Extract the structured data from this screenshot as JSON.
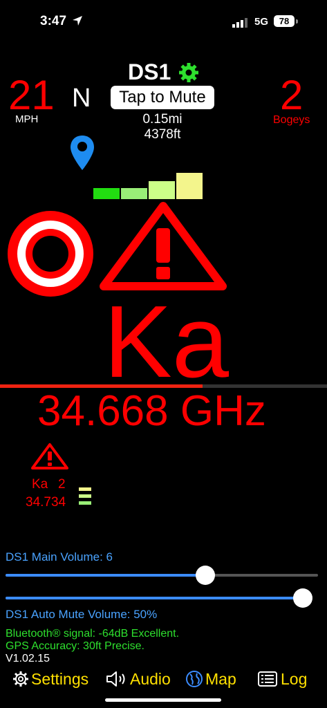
{
  "status_bar": {
    "time": "3:47",
    "network": "5G",
    "battery": "78"
  },
  "speed": {
    "value": "21",
    "unit": "MPH"
  },
  "heading": "N",
  "device": {
    "name": "DS1",
    "mute_label": "Tap to Mute",
    "distance_mi": "0.15mi",
    "distance_ft": "4378ft"
  },
  "bogeys": {
    "count": "2",
    "label": "Bogeys"
  },
  "signal_strength_level": 4,
  "alert": {
    "band": "Ka",
    "frequency": "34.668 GHz",
    "progress_fraction": 0.62
  },
  "secondary_alert": {
    "band": "Ka",
    "count": "2",
    "frequency": "34.734",
    "level": 3
  },
  "volume": {
    "main_label": "DS1 Main Volume: 6",
    "main_level": 0.64,
    "auto_mute_label": "DS1 Auto Mute Volume: 50%",
    "auto_mute_level": 1.0
  },
  "info": {
    "bluetooth": "Bluetooth® signal: -64dB Excellent.",
    "gps": "GPS Accuracy: 30ft Precise.",
    "version": "V1.02.15"
  },
  "nav": {
    "settings": "Settings",
    "audio": "Audio",
    "map": "Map",
    "log": "Log"
  },
  "colors": {
    "alert": "#ff0000",
    "accent": "#ffe000",
    "blue": "#3b8cff",
    "green": "#2ee02e"
  }
}
